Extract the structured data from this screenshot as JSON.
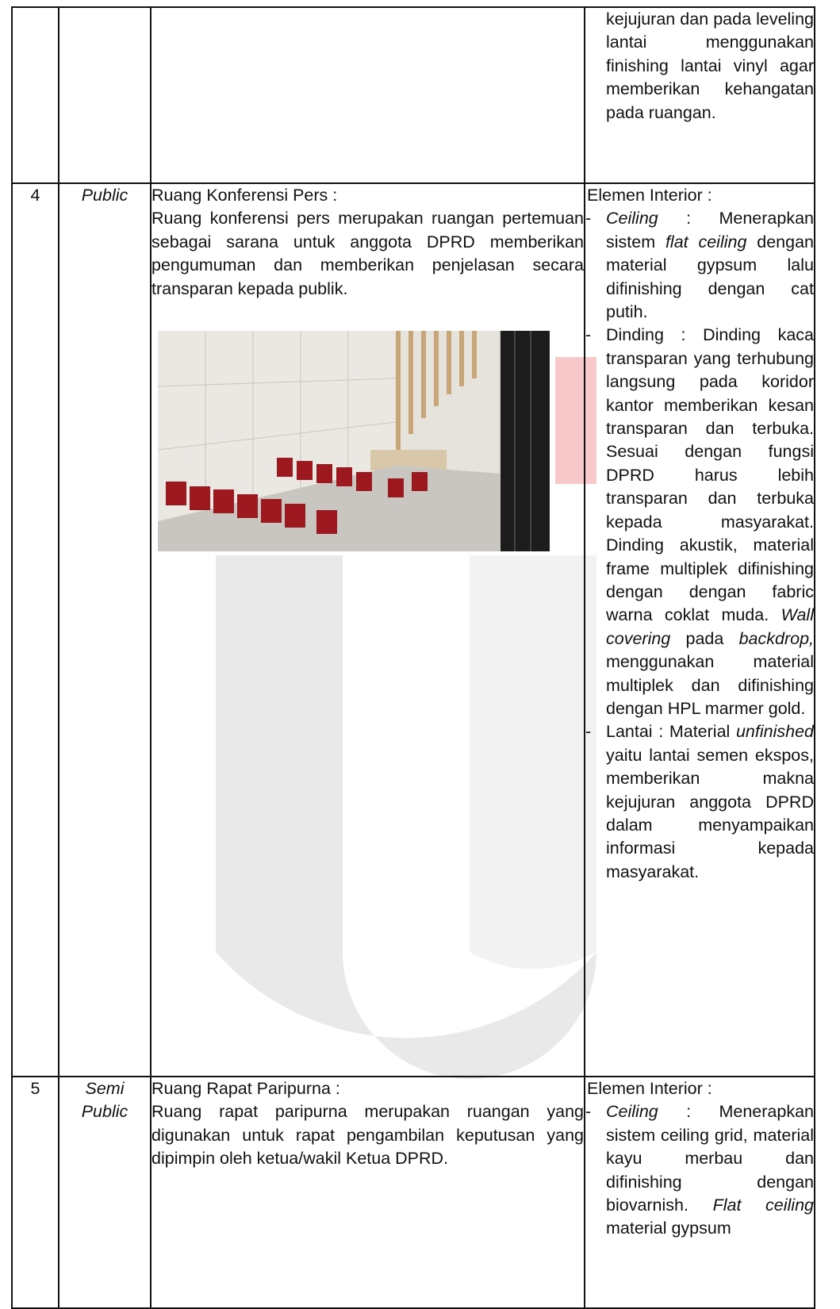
{
  "continued_row": {
    "interior_text": "kejujuran dan pada leveling lantai menggunakan finishing lantai vinyl agar memberikan kehangatan pada ruangan."
  },
  "rows": [
    {
      "no": "4",
      "zone": "Public",
      "room_title": "Ruang Konferensi Pers :",
      "room_description": "Ruang konferensi pers merupakan ruangan pertemuan sebagai sarana untuk anggota DPRD memberikan pengumuman dan memberikan penjelasan secara transparan kepada publik.",
      "image": "press-conference-room-render",
      "interior_heading": "Elemen Interior :",
      "items": [
        {
          "label": "Ceiling",
          "text": ": Menerapkan sistem",
          "em": "flat ceiling",
          "rest": "dengan material gypsum lalu difinishing dengan cat putih."
        },
        {
          "text": "Dinding : Dinding kaca transparan yang terhubung langsung pada koridor kantor memberikan kesan transparan dan terbuka. Sesuai dengan fungsi DPRD harus lebih transparan dan terbuka kepada masyarakat. Dinding akustik, material frame multiplek difinishing dengan dengan fabric warna coklat muda.",
          "em": "Wall covering",
          "mid": "pada",
          "em2": "backdrop,",
          "rest": "menggunakan material multiplek dan difinishing dengan HPL marmer gold."
        },
        {
          "text": "Lantai : Material",
          "em": "unfinished",
          "rest": "yaitu lantai semen ekspos, memberikan makna kejujuran anggota DPRD dalam menyampaikan informasi kepada masyarakat."
        }
      ]
    },
    {
      "no": "5",
      "zone_line1": "Semi",
      "zone_line2": "Public",
      "room_title": "Ruang Rapat Paripurna :",
      "room_description": "Ruang rapat paripurna merupakan ruangan yang digunakan untuk rapat pengambilan keputusan yang dipimpin oleh ketua/wakil Ketua DPRD.",
      "interior_heading": "Elemen Interior :",
      "items": [
        {
          "label": "Ceiling",
          "text": ": Menerapkan sistem ceiling grid, material kayu merbau dan difinishing dengan biovarnish.",
          "em": "Flat ceiling",
          "rest": "material gypsum"
        }
      ]
    }
  ],
  "colors": {
    "border": "#111111",
    "watermark": "#e9e9e9",
    "watermark_accent": "#f7c9cb",
    "chair_red": "#9e1820"
  }
}
